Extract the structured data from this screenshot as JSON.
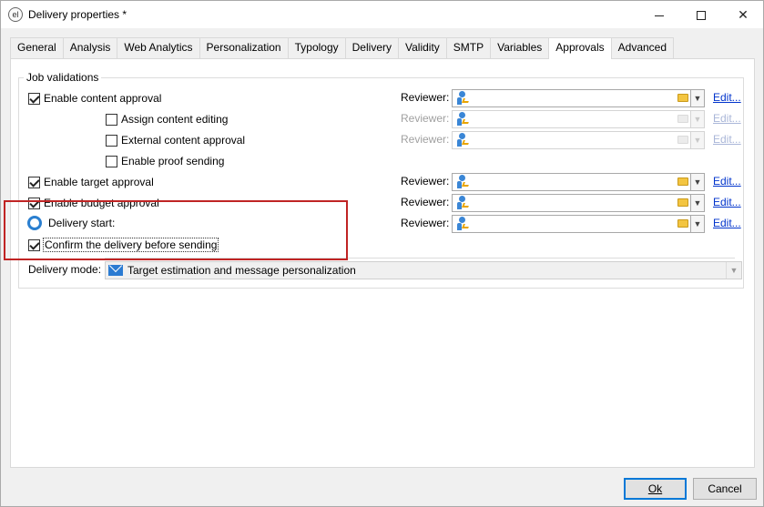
{
  "window": {
    "title": "Delivery properties *",
    "app_icon_glyph": "el"
  },
  "tabs": [
    {
      "label": "General"
    },
    {
      "label": "Analysis"
    },
    {
      "label": "Web Analytics"
    },
    {
      "label": "Personalization"
    },
    {
      "label": "Typology"
    },
    {
      "label": "Delivery"
    },
    {
      "label": "Validity"
    },
    {
      "label": "SMTP"
    },
    {
      "label": "Variables"
    },
    {
      "label": "Approvals",
      "active": true
    },
    {
      "label": "Advanced"
    }
  ],
  "job_validations": {
    "title": "Job validations",
    "items": [
      {
        "label": "Enable content approval",
        "checked": true
      },
      {
        "label": "Assign content editing",
        "checked": false
      },
      {
        "label": "External content approval",
        "checked": false
      },
      {
        "label": "Enable proof sending",
        "checked": false
      },
      {
        "label": "Enable target approval",
        "checked": true
      },
      {
        "label": "Enable budget approval",
        "checked": true
      },
      {
        "label": "Delivery start:"
      },
      {
        "label": "Confirm the delivery before sending",
        "checked": true
      }
    ],
    "reviewer_label": "Reviewer:",
    "edit_link": "Edit..."
  },
  "delivery_mode": {
    "label": "Delivery mode:",
    "value": "Target estimation and message personalization"
  },
  "buttons": {
    "ok": "Ok",
    "cancel": "Cancel"
  },
  "colors": {
    "highlight_border": "#c02424",
    "link": "#0033cc",
    "accent": "#0078d7"
  },
  "icons": {
    "reviewer": "user-key-icon",
    "folder": "folder-icon",
    "delivery_start": "gear-icon",
    "delivery_mode": "envelope-icon"
  }
}
